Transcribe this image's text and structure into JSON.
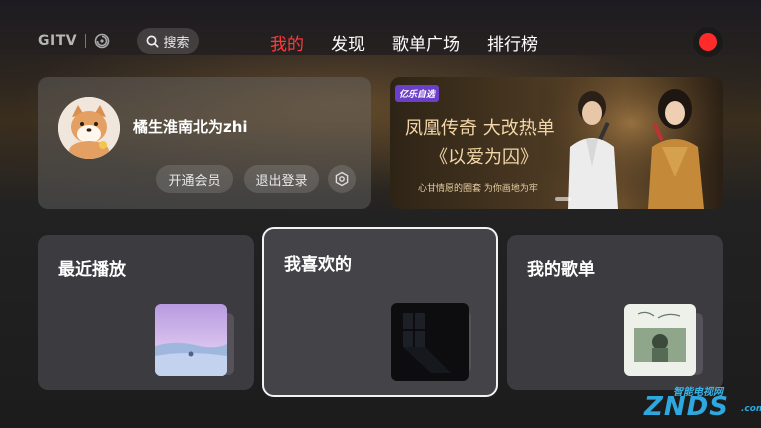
{
  "header": {
    "logo_text": "GITV",
    "search_label": "搜索",
    "nav": [
      {
        "label": "我的",
        "active": true
      },
      {
        "label": "发现",
        "active": false
      },
      {
        "label": "歌单广场",
        "active": false
      },
      {
        "label": "排行榜",
        "active": false
      }
    ]
  },
  "profile": {
    "username": "橘生淮南北为zhi",
    "vip_button": "开通会员",
    "logout_button": "退出登录",
    "settings_icon": "hexagon-gear-icon"
  },
  "banner": {
    "badge": "亿乐自选",
    "title": "凤凰传奇 大改热单",
    "subtitle": "《以爱为囚》",
    "tagline": "心甘情愿的圈套   为你画地为牢"
  },
  "cards": {
    "recent": {
      "title": "最近播放"
    },
    "liked": {
      "title": "我喜欢的"
    },
    "playlists": {
      "title": "我的歌单"
    }
  },
  "watermark": {
    "sub": "智能电视网",
    "main": "ZNDS",
    "suffix": ".com"
  },
  "colors": {
    "active_nav": "#ff3b3b",
    "record_button": "#ff2a2a",
    "focus_border": "#f2f2f2"
  }
}
